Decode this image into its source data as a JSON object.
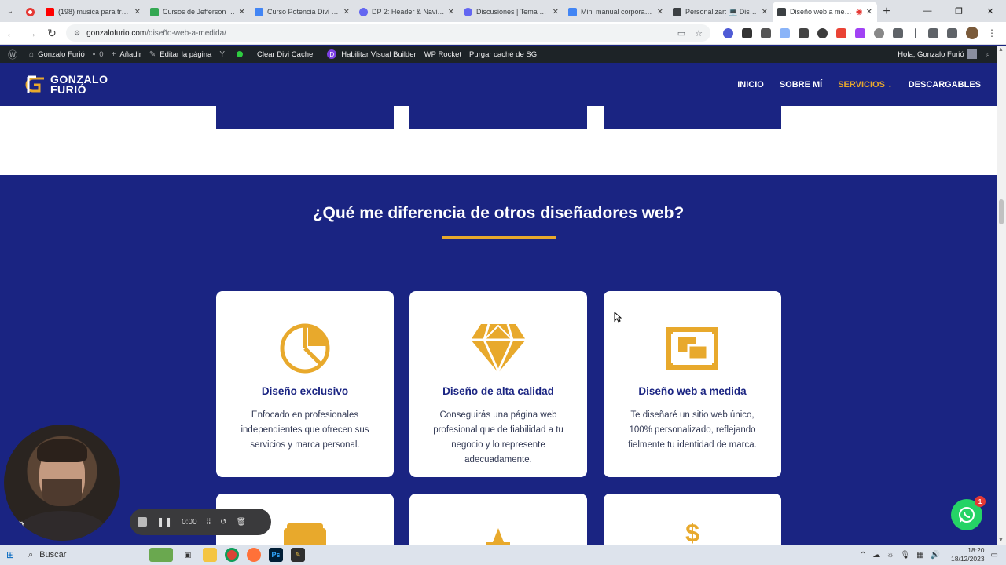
{
  "browser": {
    "tabs": [
      {
        "title": "(198) musica para trabaj...",
        "fav_color": "#ff0000",
        "active": false
      },
      {
        "title": "Cursos de Jefferson - Go...",
        "fav_color": "#34a853",
        "active": false
      },
      {
        "title": "Curso Potencia Divi con ...",
        "fav_color": "#4285f4",
        "active": false
      },
      {
        "title": "DP 2: Header & Navigati...",
        "fav_color": "#6366f1",
        "active": false
      },
      {
        "title": "Discusiones | Tema Divi ...",
        "fav_color": "#6366f1",
        "active": false
      },
      {
        "title": "Mini manual corporativo...",
        "fav_color": "#4285f4",
        "active": false
      },
      {
        "title": "Personalizar: 💻 Diseñad...",
        "fav_color": "#3c4043",
        "active": false
      },
      {
        "title": "Diseño web a medida",
        "fav_color": "#3c4043",
        "active": true
      }
    ],
    "url_host": "gonzalofurio.com",
    "url_path": "/diseño-web-a-medida/"
  },
  "wp_admin_bar": {
    "site_name": "Gonzalo Furió",
    "comments": "0",
    "add_new": "Añadir",
    "edit_page": "Editar la página",
    "clear_cache": "Clear Divi Cache",
    "visual_builder": "Habilitar Visual Builder",
    "wp_rocket": "WP Rocket",
    "purge_sg": "Purgar caché de SG",
    "greeting": "Hola, Gonzalo Furió"
  },
  "site_header": {
    "logo_line1": "GONZALO",
    "logo_line2": "FURIÓ",
    "nav": [
      {
        "label": "INICIO",
        "active": false
      },
      {
        "label": "SOBRE MÍ",
        "active": false
      },
      {
        "label": "SERVICIOS",
        "active": true,
        "has_dropdown": true
      },
      {
        "label": "DESCARGABLES",
        "active": false
      }
    ]
  },
  "section": {
    "title": "¿Qué me diferencia de otros diseñadores web?",
    "cards": [
      {
        "icon": "pie-chart-icon",
        "title": "Diseño exclusivo",
        "text": "Enfocado en profesionales independientes que ofrecen sus servicios y marca personal."
      },
      {
        "icon": "diamond-icon",
        "title": "Diseño de alta calidad",
        "text": "Conseguirás una página web profesional que de fiabilidad a tu negocio y lo represente adecuadamente."
      },
      {
        "icon": "layout-icon",
        "title": "Diseño web a medida",
        "text": "Te diseñaré un sitio web único, 100% personalizado, reflejando fielmente tu identidad de marca."
      }
    ]
  },
  "recorder": {
    "time": "0:00"
  },
  "whatsapp": {
    "badge": "1"
  },
  "taskbar": {
    "search_label": "Buscar",
    "time": "18:20",
    "date": "18/12/2023"
  },
  "colors": {
    "brand_blue": "#1a2482",
    "accent_gold": "#e8a92c",
    "whatsapp_green": "#25d366"
  }
}
